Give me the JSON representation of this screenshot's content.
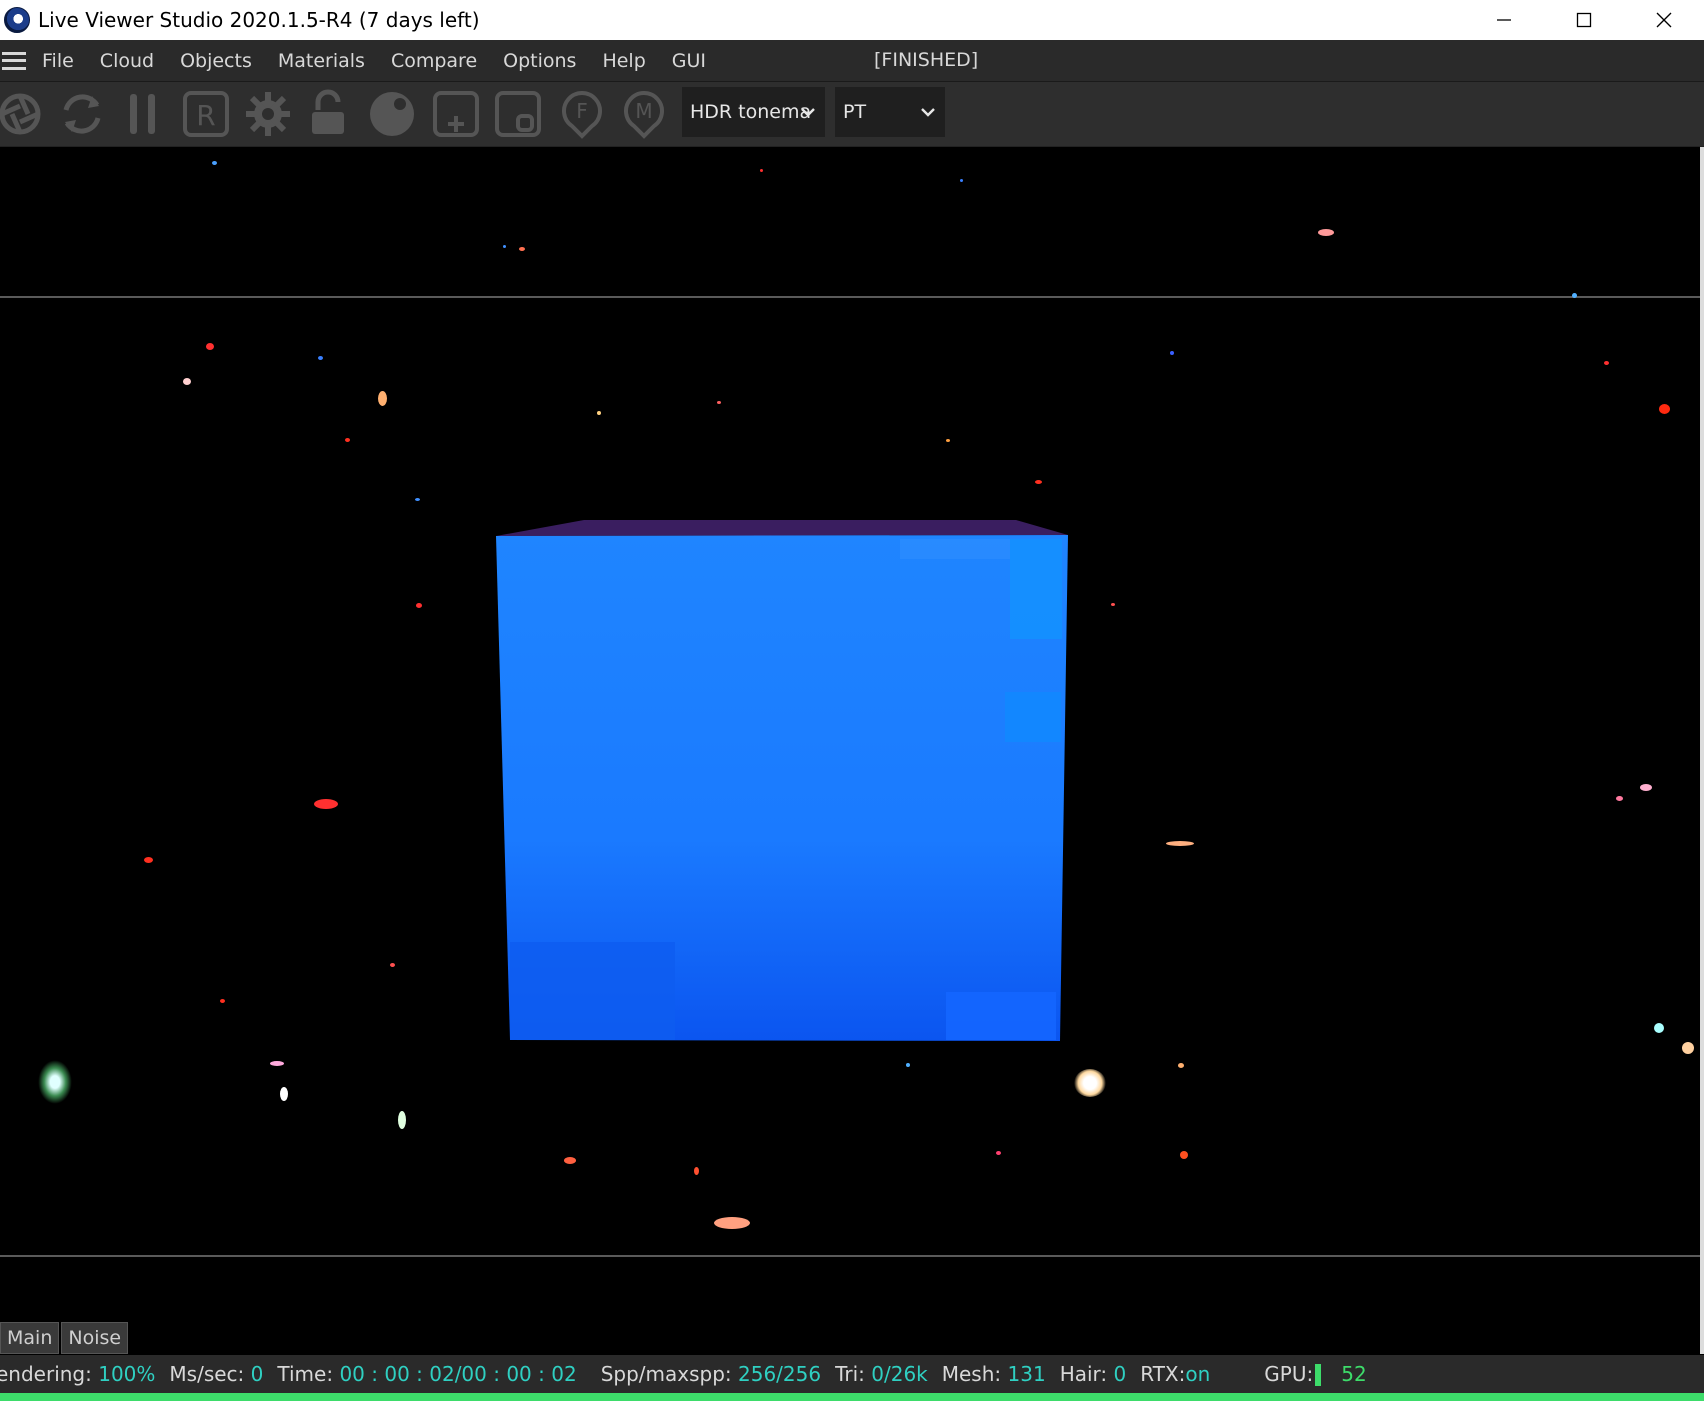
{
  "window": {
    "title": "Live Viewer Studio 2020.1.5-R4 (7 days left)",
    "controls": [
      "minimize-icon",
      "maximize-icon",
      "close-icon"
    ]
  },
  "menubar": {
    "items": [
      "File",
      "Cloud",
      "Objects",
      "Materials",
      "Compare",
      "Options",
      "Help",
      "GUI"
    ],
    "status": "[FINISHED]"
  },
  "toolbar": {
    "icons": [
      "aperture-icon",
      "refresh-icon",
      "pause-icon",
      "r-box-icon",
      "gear-icon",
      "unlock-icon",
      "sphere-icon",
      "plus-box-icon",
      "o-box-icon",
      "f-pin-icon",
      "m-pin-icon"
    ],
    "tonemap_value": "HDR tonema",
    "kernel_value": "PT"
  },
  "tabs": [
    "Main",
    "Noise"
  ],
  "status": {
    "rendering_label": "endering:",
    "rendering_value": "100%",
    "mssec_label": "Ms/sec:",
    "mssec_value": "0",
    "time_label": "Time:",
    "time_value": "00 : 00 : 02/00 : 00 : 02",
    "spp_label": "Spp/maxspp:",
    "spp_value": "256/256",
    "tri_label": "Tri:",
    "tri_value": "0/26k",
    "mesh_label": "Mesh:",
    "mesh_value": "131",
    "hair_label": "Hair:",
    "hair_value": "0",
    "rtx_label": "RTX:",
    "rtx_value": "on",
    "gpu_label": "GPU:",
    "gpu_value": "52"
  },
  "colors": {
    "accent_teal": "#2fd0c2",
    "gpu_green": "#3ddc6a",
    "cube_blue": "#1a7fff"
  }
}
